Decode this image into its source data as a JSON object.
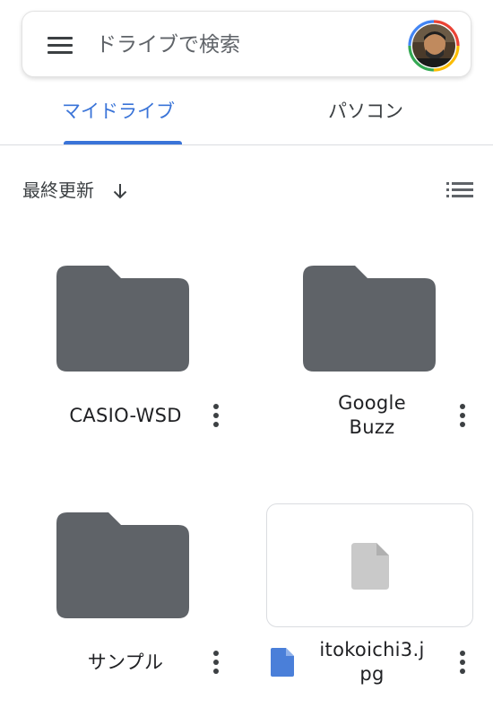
{
  "search": {
    "placeholder": "ドライブで検索",
    "menu_icon": "hamburger-menu-icon",
    "avatar_icon": "account-avatar"
  },
  "tabs": [
    {
      "label": "マイドライブ",
      "selected": true
    },
    {
      "label": "パソコン",
      "selected": false
    }
  ],
  "sort": {
    "label": "最終更新",
    "direction_icon": "arrow-down-icon"
  },
  "view_toggle_icon": "list-view-icon",
  "items": [
    {
      "name": "CASIO-WSD",
      "type": "folder"
    },
    {
      "name_lines": [
        "Google",
        "Buzz"
      ],
      "type": "folder"
    },
    {
      "name": "サンプル",
      "type": "folder"
    },
    {
      "name_lines": [
        "itokoichi3.j",
        "pg"
      ],
      "type": "file",
      "file_icon": "doc-file-icon"
    }
  ],
  "colors": {
    "accent": "#3a74d8",
    "folder": "#5f6368",
    "file_icon": "#4a7fd9",
    "thumbnail_placeholder": "#c9c9c9"
  }
}
